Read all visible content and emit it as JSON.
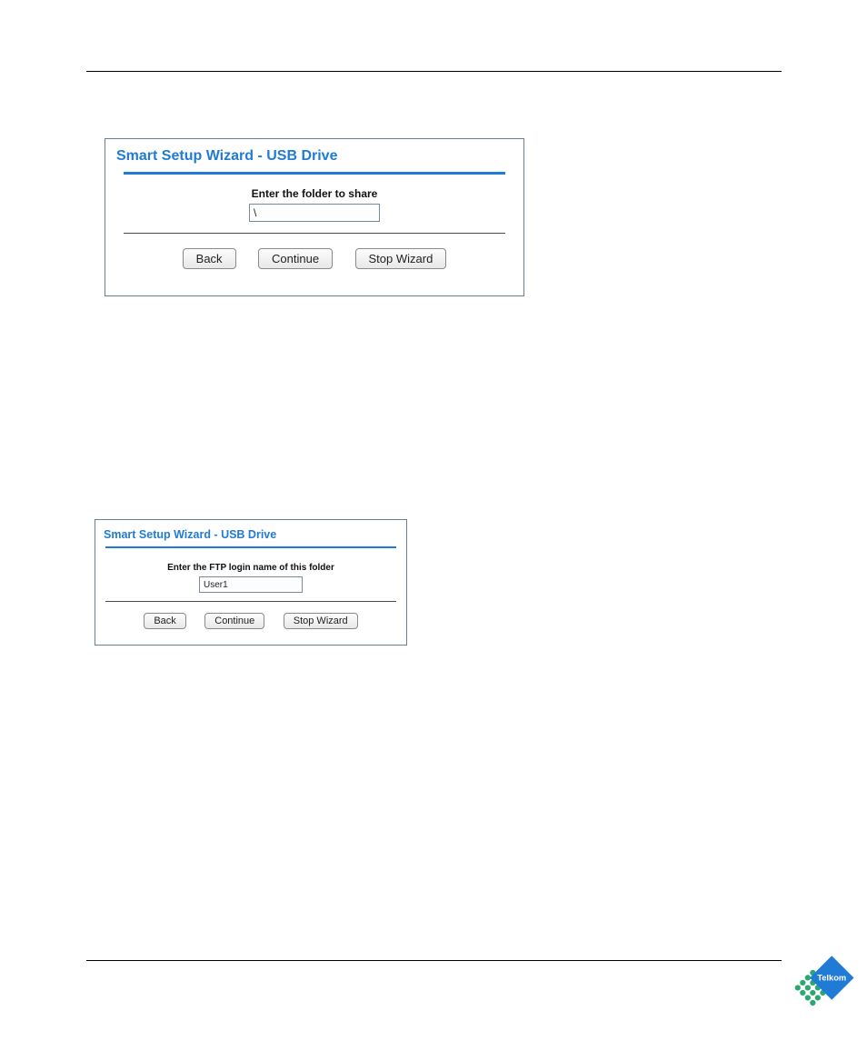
{
  "wizard1": {
    "title": "Smart Setup Wizard - USB Drive",
    "prompt": "Enter the folder to share",
    "input_value": "\\",
    "buttons": {
      "back": "Back",
      "continue": "Continue",
      "stop": "Stop Wizard"
    }
  },
  "wizard2": {
    "title": "Smart Setup Wizard - USB Drive",
    "prompt": "Enter the FTP login name of this folder",
    "input_value": "User1",
    "buttons": {
      "back": "Back",
      "continue": "Continue",
      "stop": "Stop Wizard"
    }
  },
  "logo": {
    "brand": "Telkom",
    "primary_color": "#1f7bd6",
    "accent_color": "#2aa86f"
  }
}
